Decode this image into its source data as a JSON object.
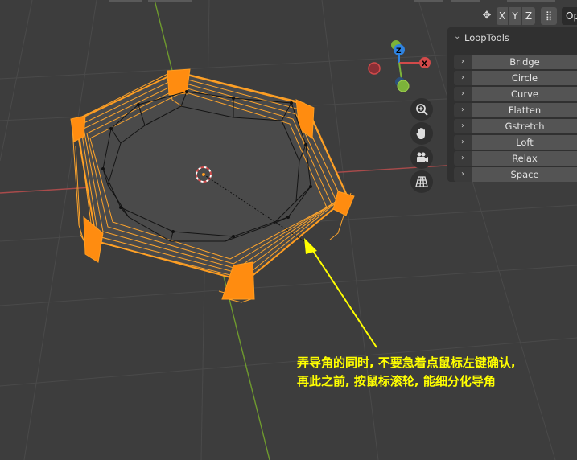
{
  "header": {
    "axis_buttons": [
      "X",
      "Y",
      "Z"
    ],
    "options_label": "Op"
  },
  "gizmo": {
    "z_label": "Z",
    "x_label": "X"
  },
  "nav_tools": [
    "zoom-icon",
    "hand-icon",
    "camera-icon",
    "grid-icon"
  ],
  "loop_tools": {
    "title": "LoopTools",
    "items": [
      {
        "label": "Bridge"
      },
      {
        "label": "Circle"
      },
      {
        "label": "Curve"
      },
      {
        "label": "Flatten"
      },
      {
        "label": "Gstretch"
      },
      {
        "label": "Loft"
      },
      {
        "label": "Relax"
      },
      {
        "label": "Space"
      }
    ]
  },
  "annotation": {
    "line1": "弄导角的同时, 不要急着点鼠标左键确认,",
    "line2": "再此之前, 按鼠标滚轮, 能细分化导角"
  },
  "colors": {
    "viewport_bg": "#3d3d3d",
    "selection_orange": "#ff9d20",
    "annotation_yellow": "#ffff00",
    "axis_x_red": "#d04a4a",
    "axis_y_green": "#7cb33a"
  }
}
